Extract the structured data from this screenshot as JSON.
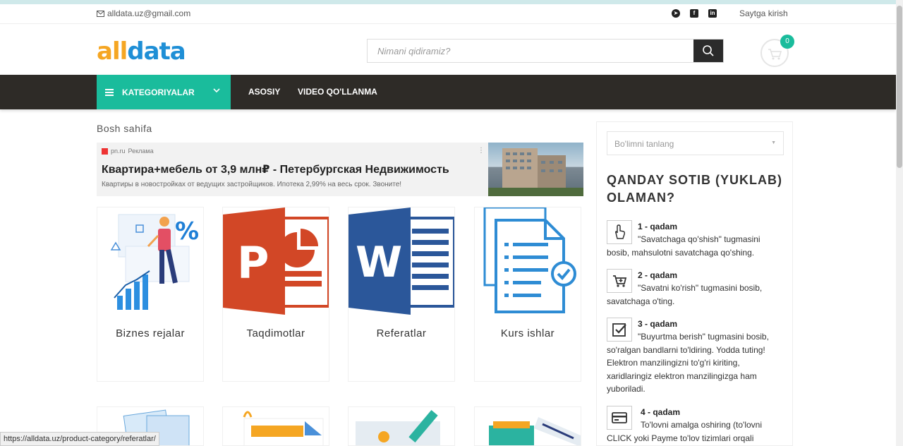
{
  "topbar": {
    "email": "alldata.uz@gmail.com",
    "social": [
      "telegram-icon",
      "facebook-icon",
      "linkedin-icon"
    ],
    "login": "Saytga kirish"
  },
  "header": {
    "logo_part1": "all",
    "logo_part2": "data",
    "search_placeholder": "Nimani qidiramiz?",
    "cart_count": "0"
  },
  "nav": {
    "categories": "KATEGORIYALAR",
    "links": [
      "ASOSIY",
      "VIDEO QO'LLANMA"
    ]
  },
  "breadcrumb": "Bosh sahifa",
  "ad": {
    "source": "pn.ru",
    "source_tag": "Реклама",
    "title": "Квартира+мебель от 3,9 млн₽ - Петербургская Недвижимость",
    "description": "Квартиры в новостройках от ведущих застройщиков. Ипотека 2,99% на весь срок. Звоните!"
  },
  "products": [
    {
      "label": "Biznes rejalar"
    },
    {
      "label": "Taqdimotlar"
    },
    {
      "label": "Referatlar"
    },
    {
      "label": "Kurs ishlar"
    }
  ],
  "sidebar": {
    "select_placeholder": "Bo'limni tanlang",
    "heading": "QANDAY SOTIB (YUKLAB) OLAMAN?",
    "steps": [
      {
        "title": "1 - qadam",
        "text": "\"Savatchaga qo'shish\" tugmasini bosib, mahsulotni savatchaga qo'shing."
      },
      {
        "title": "2 - qadam",
        "text": "\"Savatni ko'rish\" tugmasini bosib, savatchaga o'ting."
      },
      {
        "title": "3 - qadam",
        "text": "\"Buyurtma berish\" tugmasini bosib, so'ralgan bandlarni to'ldiring. Yodda tuting! Elektron manzilingizni to'g'ri kiriting, xaridlaringiz elektron manzilingizga ham yuboriladi."
      },
      {
        "title": "4 - qadam",
        "text": "To'lovni amalga oshiring (to'lovni CLICK yoki Payme to'lov tizimlari orqali"
      }
    ]
  },
  "statusbar": "https://alldata.uz/product-category/referatlar/",
  "colors": {
    "accent": "#1abc9c",
    "nav_bg": "#2e2b27",
    "logo_orange": "#f5a623",
    "logo_blue": "#1f8fd6"
  }
}
